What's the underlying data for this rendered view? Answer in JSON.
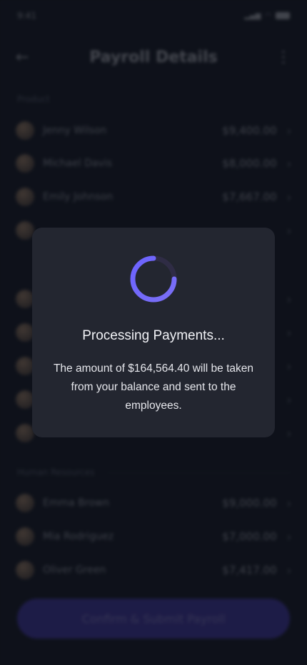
{
  "status_bar": {
    "time": "9:41"
  },
  "nav": {
    "back_icon": "arrow-left-icon",
    "title": "Payroll Details",
    "more_icon": "more-vertical-icon"
  },
  "sections": [
    {
      "label": "Product",
      "rows": [
        {
          "name": "Jenny Wilson",
          "amount": "$9,400.00"
        },
        {
          "name": "Michael Davis",
          "amount": "$8,000.00"
        },
        {
          "name": "Emily Johnson",
          "amount": "$7,667.00"
        },
        {
          "name": "",
          "amount": ""
        }
      ]
    },
    {
      "label": "",
      "rows": [
        {
          "name": "",
          "amount": ""
        },
        {
          "name": "",
          "amount": ""
        },
        {
          "name": "",
          "amount": ""
        },
        {
          "name": "",
          "amount": ""
        },
        {
          "name": "",
          "amount": ""
        }
      ]
    },
    {
      "label": "Human Resources",
      "rows": [
        {
          "name": "Emma Brown",
          "amount": "$9,000.00"
        },
        {
          "name": "Mia Rodriguez",
          "amount": "$7,000.00"
        },
        {
          "name": "Oliver Green",
          "amount": "$7,417.00"
        }
      ]
    }
  ],
  "cta": {
    "label": "Confirm & Submit Payroll"
  },
  "modal": {
    "title": "Processing Payments...",
    "message": "The amount of $164,564.40 will be taken from your balance and sent to the employees.",
    "spinner_color": "#6c63ff"
  },
  "colors": {
    "background": "#151925",
    "modal_bg": "#232630",
    "accent": "#5b4fe0"
  }
}
